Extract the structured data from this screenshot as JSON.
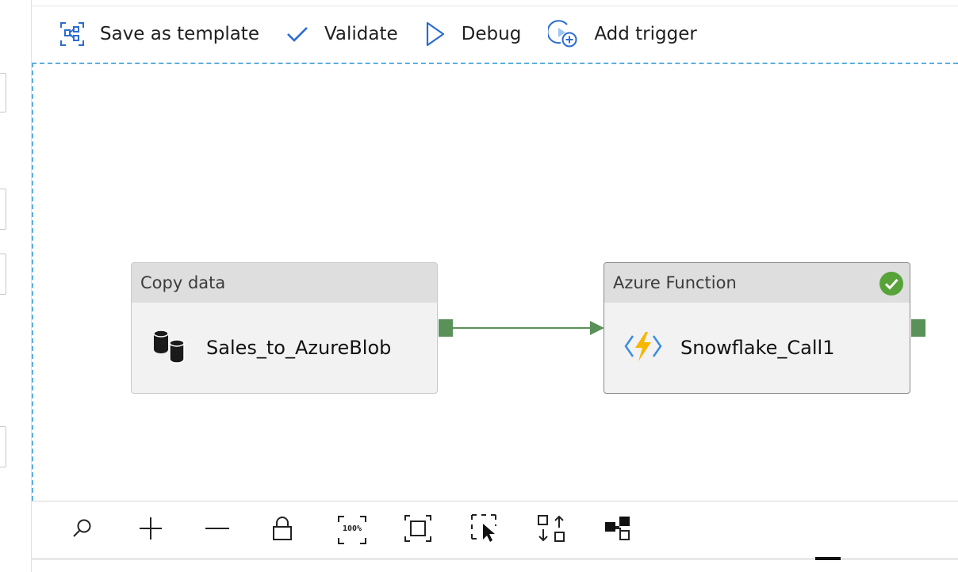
{
  "toolbar": {
    "buttons": [
      {
        "label": "Save as template",
        "icon": "template-icon"
      },
      {
        "label": "Validate",
        "icon": "checkmark-icon"
      },
      {
        "label": "Debug",
        "icon": "play-icon"
      },
      {
        "label": "Add trigger",
        "icon": "trigger-add-icon"
      }
    ]
  },
  "activities": [
    {
      "type": "Copy data",
      "name": "Sales_to_AzureBlob",
      "icon": "copy-data-icon"
    },
    {
      "type": "Azure Function",
      "name": "Snowflake_Call1",
      "icon": "azure-function-icon",
      "status": "succeeded"
    }
  ],
  "canvas_controls": [
    {
      "name": "search-icon"
    },
    {
      "name": "zoom-in-icon"
    },
    {
      "name": "zoom-out-icon"
    },
    {
      "name": "lock-icon"
    },
    {
      "name": "zoom-100-icon",
      "text": "100%"
    },
    {
      "name": "fit-to-screen-icon"
    },
    {
      "name": "select-icon"
    },
    {
      "name": "auto-align-icon"
    },
    {
      "name": "layout-icon"
    }
  ],
  "colors": {
    "accent": "#2b6cd0",
    "connector": "#5a9158",
    "success": "#57a339",
    "canvas_border": "#5aaee0"
  }
}
